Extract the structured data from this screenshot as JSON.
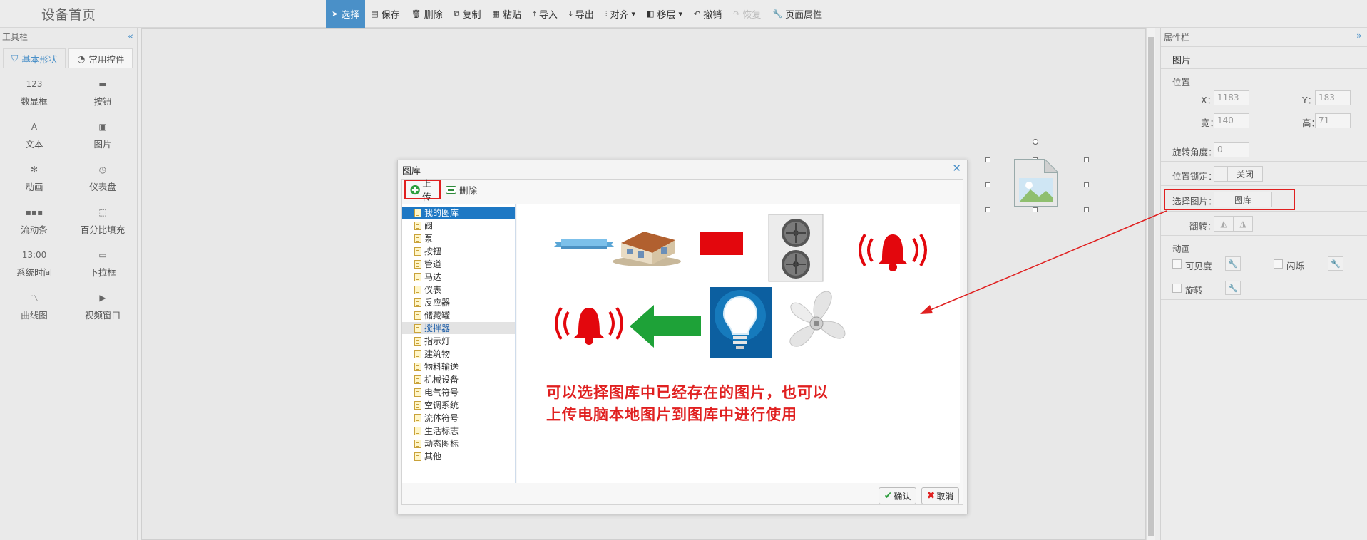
{
  "app": {
    "title": "设备首页"
  },
  "toolbar": {
    "items": [
      {
        "label": "选择",
        "icon": "pointer-icon",
        "active": true
      },
      {
        "label": "保存",
        "icon": "save-icon"
      },
      {
        "label": "删除",
        "icon": "trash-icon"
      },
      {
        "label": "复制",
        "icon": "copy-icon"
      },
      {
        "label": "粘贴",
        "icon": "paste-icon"
      },
      {
        "label": "导入",
        "icon": "import-icon"
      },
      {
        "label": "导出",
        "icon": "export-icon"
      },
      {
        "label": "对齐",
        "icon": "align-icon",
        "dropdown": true
      },
      {
        "label": "移层",
        "icon": "layer-icon",
        "dropdown": true
      },
      {
        "label": "撤销",
        "icon": "undo-icon"
      },
      {
        "label": "恢复",
        "icon": "redo-icon",
        "disabled": true
      },
      {
        "label": "页面属性",
        "icon": "wrench-icon"
      }
    ]
  },
  "left_panel": {
    "title": "工具栏",
    "tabs": [
      {
        "label": "基本形状",
        "icon": "bookmark-icon"
      },
      {
        "label": "常用控件",
        "icon": "dashboard-icon",
        "active": true
      }
    ],
    "tools": [
      {
        "label": "数显框",
        "glyph": "123",
        "icon": "number-box-icon"
      },
      {
        "label": "按钮",
        "glyph": "▬",
        "icon": "button-icon"
      },
      {
        "label": "文本",
        "glyph": "A",
        "icon": "text-icon"
      },
      {
        "label": "图片",
        "glyph": "▣",
        "icon": "image-icon"
      },
      {
        "label": "动画",
        "glyph": "✻",
        "icon": "animation-icon"
      },
      {
        "label": "仪表盘",
        "glyph": "◷",
        "icon": "gauge-icon"
      },
      {
        "label": "流动条",
        "glyph": "▪▪▪",
        "icon": "flow-bar-icon"
      },
      {
        "label": "百分比填充",
        "glyph": "⬚",
        "icon": "percent-fill-icon"
      },
      {
        "label": "系统时间",
        "glyph": "13:00",
        "icon": "system-time-icon"
      },
      {
        "label": "下拉框",
        "glyph": "▭",
        "icon": "dropdown-icon"
      },
      {
        "label": "曲线图",
        "glyph": "〽",
        "icon": "curve-chart-icon"
      },
      {
        "label": "视频窗口",
        "glyph": "▶",
        "icon": "video-window-icon"
      }
    ]
  },
  "right_panel": {
    "title": "属性栏",
    "section_title": "图片",
    "position": {
      "label": "位置",
      "x_label": "X：",
      "x_value": "1183",
      "y_label": "Y：",
      "y_value": "183",
      "w_label": "宽：",
      "w_value": "140",
      "h_label": "高：",
      "h_value": "71"
    },
    "rotation": {
      "label": "旋转角度：",
      "value": "0"
    },
    "lock": {
      "label": "位置锁定：",
      "value": "关闭"
    },
    "select_image": {
      "label": "选择图片：",
      "button": "图库"
    },
    "flip": {
      "label": "翻转："
    },
    "animation": {
      "label": "动画",
      "visibility": "可见度",
      "blink": "闪烁",
      "rotate": "旋转"
    }
  },
  "dialog": {
    "title": "图库",
    "upload": "上传",
    "delete": "删除",
    "categories": [
      "我的图库",
      "阀",
      "泵",
      "按钮",
      "管道",
      "马达",
      "仪表",
      "反应器",
      "储藏罐",
      "搅拌器",
      "指示灯",
      "建筑物",
      "物料输送",
      "机械设备",
      "电气符号",
      "空调系统",
      "流体符号",
      "生活标志",
      "动态图标",
      "其他"
    ],
    "selected_category": "我的图库",
    "hovered_category": "搅拌器",
    "gallery_items": [
      {
        "name": "ribbon-banner",
        "icon": "ribbon-banner-icon"
      },
      {
        "name": "house",
        "icon": "house-icon"
      },
      {
        "name": "red-rectangle",
        "icon": "red-rectangle-icon"
      },
      {
        "name": "air-conditioner-unit",
        "icon": "air-conditioner-icon"
      },
      {
        "name": "alarm-bell",
        "icon": "alarm-bell-icon"
      },
      {
        "name": "alarm-bell-2",
        "icon": "alarm-bell-icon"
      },
      {
        "name": "green-arrow",
        "icon": "arrow-left-icon"
      },
      {
        "name": "light-bulb",
        "icon": "light-bulb-icon"
      },
      {
        "name": "fan",
        "icon": "fan-icon"
      }
    ],
    "note_line1": "可以选择图库中已经存在的图片，也可以",
    "note_line2": "上传电脑本地图片到图库中进行使用",
    "ok": "确认",
    "cancel": "取消"
  },
  "colors": {
    "accent": "#4a90c8",
    "annotation": "#e02020",
    "selected": "#1e78c4"
  }
}
